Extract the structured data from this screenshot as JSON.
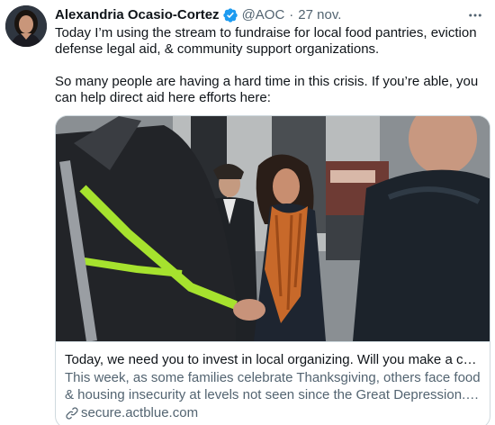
{
  "tweet": {
    "author_name": "Alexandria Ocasio-Cortez",
    "handle": "@AOC",
    "separator": "·",
    "date": "27 nov.",
    "verified_icon": "verified-badge-icon",
    "more_icon": "more-options-icon",
    "paragraphs": [
      "Today I’m using the stream to fundraise for local food pantries, eviction defense legal aid, & community support organizations.",
      "So many people are having a hard time in this crisis. If you’re able, you can help direct aid here efforts here:"
    ]
  },
  "card": {
    "title": "Today, we need you to invest in local organizing. Will you make a contribution?",
    "description": "This week, as some families celebrate Thanksgiving, others face food & housing insecurity at levels not seen since the Great Depression. These organizations are working every day to help.",
    "domain": "secure.actblue.com",
    "link_icon": "link-icon"
  },
  "colors": {
    "text_primary": "#0f1419",
    "text_secondary": "#536471",
    "verified_blue": "#1d9bf0",
    "border": "#cfd9de"
  }
}
